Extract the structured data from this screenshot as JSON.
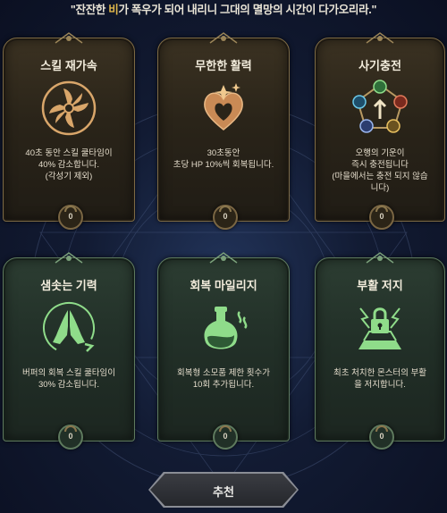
{
  "header": {
    "quote_pre": "\"잔잔한 ",
    "quote_highlight": "비",
    "quote_post": "가 폭우가 되어 내리니 그대의 멸망의 시간이 다가오리라.\""
  },
  "cards": [
    {
      "title": "스킬 재가속",
      "description": "40초 동안 스킬 쿨타임이\n40% 감소합니다.\n(각성기 제외)",
      "cost": "0",
      "icon": "spiral-blades-icon"
    },
    {
      "title": "무한한 활력",
      "description": "30초동안\n초당 HP 10%씩 회복됩니다.",
      "cost": "0",
      "icon": "flame-heart-icon"
    },
    {
      "title": "사기충전",
      "description": "오행의 기운이\n즉시 충전됩니다\n(마을에서는 충전 되지 않습\n니다)",
      "cost": "0",
      "icon": "five-elements-icon"
    },
    {
      "title": "샘솟는 기력",
      "description": "버퍼의 회복 스킬 쿨타임이\n30% 감소됩니다.",
      "cost": "0",
      "icon": "praying-hands-icon"
    },
    {
      "title": "회복 마일리지",
      "description": "회복형 소모품 제한 횟수가\n10회 추가됩니다.",
      "cost": "0",
      "icon": "potion-flask-icon"
    },
    {
      "title": "부활 저지",
      "description": "최초 처치한 몬스터의 부활\n을 저지합니다.",
      "cost": "0",
      "icon": "locked-altar-icon"
    }
  ],
  "recommend_button": {
    "label": "추천"
  },
  "colors": {
    "gold_accent": "#e0b74a",
    "icon_gold": "#d9a66a",
    "icon_green": "#8fdc8a"
  }
}
